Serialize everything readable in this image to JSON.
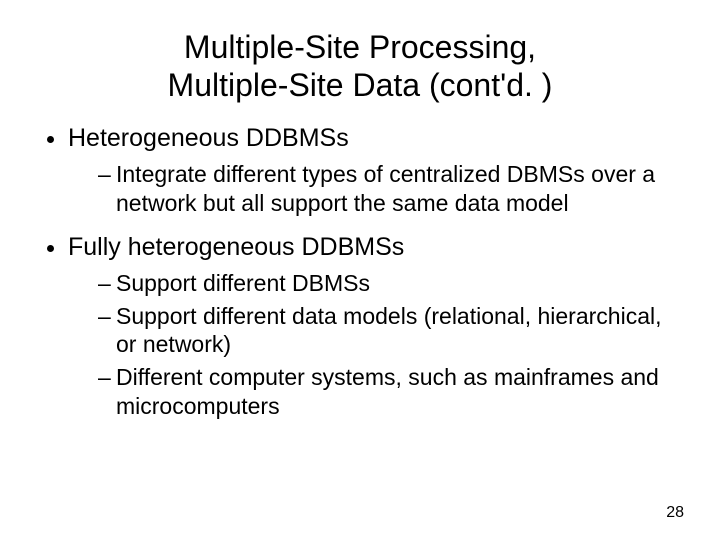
{
  "title_line1": "Multiple-Site Processing,",
  "title_line2": "Multiple-Site Data (cont'd. )",
  "bullets": [
    {
      "text": "Heterogeneous DDBMSs",
      "sub": [
        "Integrate different types of centralized DBMSs over a network but all support the same data model"
      ]
    },
    {
      "text": "Fully heterogeneous DDBMSs",
      "sub": [
        "Support different DBMSs",
        "Support different data models (relational, hierarchical, or network)",
        "Different computer systems, such as mainframes and microcomputers"
      ]
    }
  ],
  "page_number": "28"
}
